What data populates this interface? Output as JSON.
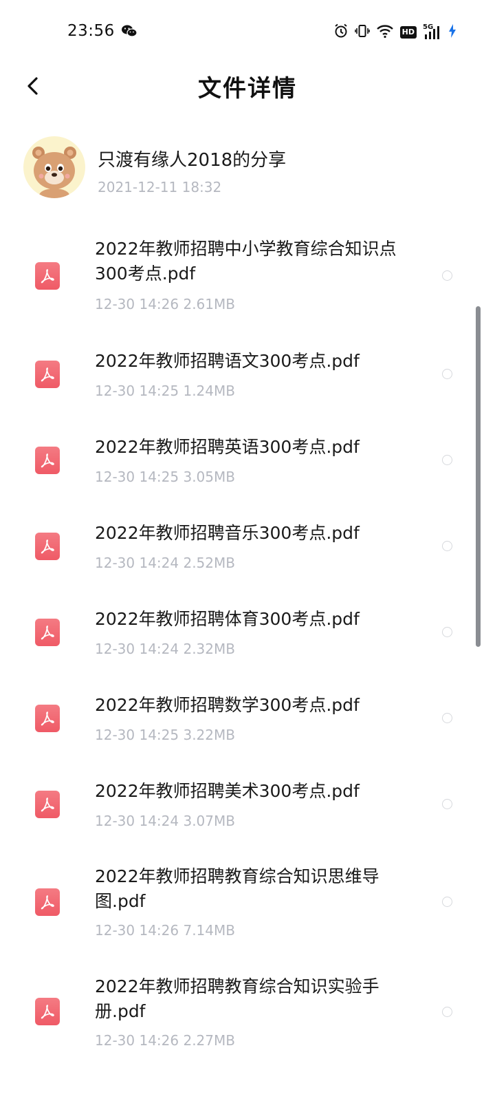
{
  "status": {
    "time": "23:56",
    "hd_label": "HD",
    "network_label": "5G"
  },
  "header": {
    "title": "文件详情"
  },
  "sharer": {
    "name": "只渡有缘人2018的分享",
    "time": "2021-12-11  18:32"
  },
  "files": [
    {
      "name": "2022年教师招聘中小学教育综合知识点300考点.pdf",
      "meta": "12-30  14:26  2.61MB"
    },
    {
      "name": "2022年教师招聘语文300考点.pdf",
      "meta": "12-30  14:25  1.24MB"
    },
    {
      "name": "2022年教师招聘英语300考点.pdf",
      "meta": "12-30  14:25  3.05MB"
    },
    {
      "name": "2022年教师招聘音乐300考点.pdf",
      "meta": "12-30  14:24  2.52MB"
    },
    {
      "name": "2022年教师招聘体育300考点.pdf",
      "meta": "12-30  14:24  2.32MB"
    },
    {
      "name": "2022年教师招聘数学300考点.pdf",
      "meta": "12-30  14:25  3.22MB"
    },
    {
      "name": "2022年教师招聘美术300考点.pdf",
      "meta": "12-30  14:24  3.07MB"
    },
    {
      "name": "2022年教师招聘教育综合知识思维导图.pdf",
      "meta": "12-30  14:26  7.14MB"
    },
    {
      "name": "2022年教师招聘教育综合知识实验手册.pdf",
      "meta": "12-30  14:26  2.27MB"
    }
  ],
  "colors": {
    "accent_pdf": "#ef5a66",
    "meta_gray": "#b5b8c0",
    "avatar_bg": "#fbf3cc"
  },
  "icons": {
    "back": "chevron-left-icon",
    "file": "pdf-icon",
    "select": "radio-icon"
  }
}
